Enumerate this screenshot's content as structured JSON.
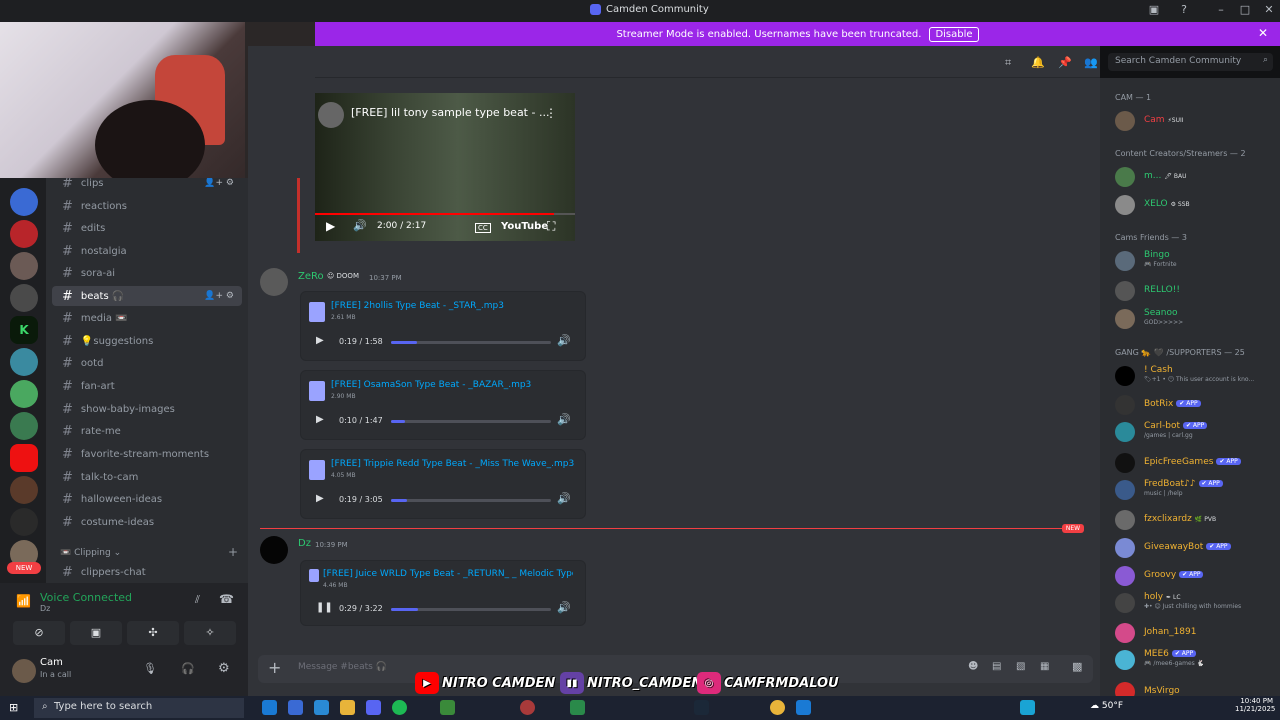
{
  "window": {
    "title": "Camden Community"
  },
  "banner": {
    "text": "Streamer Mode is enabled. Usernames have been truncated.",
    "button": "Disable"
  },
  "header": {
    "search_placeholder": "Search Camden Community"
  },
  "channels": [
    {
      "name": "clips",
      "active": false
    },
    {
      "name": "reactions"
    },
    {
      "name": "edits"
    },
    {
      "name": "nostalgia"
    },
    {
      "name": "sora-ai"
    },
    {
      "name": "beats 🎧",
      "active": true
    },
    {
      "name": "media 📼"
    },
    {
      "name": "💡suggestions"
    },
    {
      "name": "ootd"
    },
    {
      "name": "fan-art"
    },
    {
      "name": "show-baby-images"
    },
    {
      "name": "rate-me"
    },
    {
      "name": "favorite-stream-moments"
    },
    {
      "name": "talk-to-cam"
    },
    {
      "name": "halloween-ideas"
    },
    {
      "name": "costume-ideas"
    }
  ],
  "category": {
    "label": "📼 Clipping"
  },
  "channel_after_cat": "clippers-chat",
  "server_badge": "NEW",
  "voice": {
    "status": "Voice Connected",
    "sub": "Dz"
  },
  "user": {
    "name": "Cam",
    "status": "In a call"
  },
  "video": {
    "title": "[FREE] lil tony sample type beat - ...",
    "time": "2:00 / 2:17",
    "brand": "YouTube",
    "progress": 0.92
  },
  "messages": [
    {
      "author": "ZeRo",
      "tag": "DOOM",
      "time": "10:37 PM"
    },
    {
      "author": "Dz",
      "time": "10:39 PM"
    }
  ],
  "attachments": [
    {
      "name": "[FREE] 2hollis Type Beat - _STAR_.mp3",
      "size": "2.61 MB",
      "time": "0:19 / 1:58",
      "progress": 0.16
    },
    {
      "name": "[FREE] OsamaSon Type Beat - _BAZAR_.mp3",
      "size": "2.90 MB",
      "time": "0:10 / 1:47",
      "progress": 0.09
    },
    {
      "name": "[FREE] Trippie Redd Type Beat - _Miss The Wave_.mp3",
      "size": "4.05 MB",
      "time": "0:19 / 3:05",
      "progress": 0.1
    },
    {
      "name": "[FREE] Juice WRLD Type Beat - _RETURN_ _ Melodic Type",
      "size": "4.46 MB",
      "time": "0:29 / 3:22",
      "progress": 0.17
    }
  ],
  "new_label": "NEW",
  "composer": {
    "placeholder": "Message #beats 🎧"
  },
  "members": {
    "groups": [
      {
        "title": "CAM — 1",
        "items": [
          {
            "name": "Cam",
            "tag": "⚡SUII",
            "color": "#f23f43"
          }
        ]
      },
      {
        "title": "Content Creators/Streamers — 2",
        "items": [
          {
            "name": "m...",
            "tag": "🖊 BAU",
            "color": "#2dc770"
          },
          {
            "name": "XELO",
            "tag": "⚙ SSB",
            "color": "#2dc770"
          }
        ]
      },
      {
        "title": "Cams Friends — 3",
        "items": [
          {
            "name": "Bingo",
            "status": "🎮 Fortnite",
            "color": "#2dc770"
          },
          {
            "name": "RELLO!!",
            "color": "#2dc770"
          },
          {
            "name": "Seanoo",
            "status": "GOD>>>>>",
            "color": "#2dc770"
          }
        ]
      },
      {
        "title": "GANG 🐆 🖤 /SUPPORTERS — 25",
        "items": [
          {
            "name": "! Cash",
            "status": "🏷+1 • 😶 This user account is kno...",
            "color": "#f0b232"
          },
          {
            "name": "BotRix",
            "app": "✔ APP",
            "color": "#f0b232"
          },
          {
            "name": "Carl-bot",
            "app": "✔ APP",
            "status": "/games | carl.gg",
            "color": "#f0b232"
          },
          {
            "name": "EpicFreeGames",
            "app": "✔ APP",
            "color": "#f0b232"
          },
          {
            "name": "FredBoat♪♪",
            "app": "✔ APP",
            "status": "music | /help",
            "color": "#f0b232"
          },
          {
            "name": "fzxclixardz",
            "tag": "🌿 PVB",
            "color": "#f0b232"
          },
          {
            "name": "GiveawayBot",
            "app": "✔ APP",
            "color": "#f0b232"
          },
          {
            "name": "Groovy",
            "app": "✔ APP",
            "color": "#f0b232"
          },
          {
            "name": "holy",
            "tag": "✒ LC",
            "status": "✚• 😊 Just chilling with hommies",
            "color": "#f0b232"
          },
          {
            "name": "Johan_1891",
            "color": "#f0b232"
          },
          {
            "name": "MEE6",
            "app": "✔ APP",
            "status": "🎮 /mee6-games 🐇",
            "color": "#f0b232"
          },
          {
            "name": "MsVirgo",
            "color": "#f0b232"
          }
        ]
      }
    ]
  },
  "socials": [
    {
      "label": "NITRO CAMDEN",
      "color": "#ff0000"
    },
    {
      "label": "NITRO_CAMDEN",
      "color": "#6441a5"
    },
    {
      "label": "CAMFRMDALOU",
      "color": "#dd2a7b"
    }
  ],
  "taskbar": {
    "search_placeholder": "Type here to search",
    "temp": "50°F",
    "time": "10:40 PM",
    "date": "11/21/2025"
  },
  "colors": {
    "accent": "#5865f2",
    "streamer_banner": "#9b26e8",
    "online": "#23a55a"
  }
}
